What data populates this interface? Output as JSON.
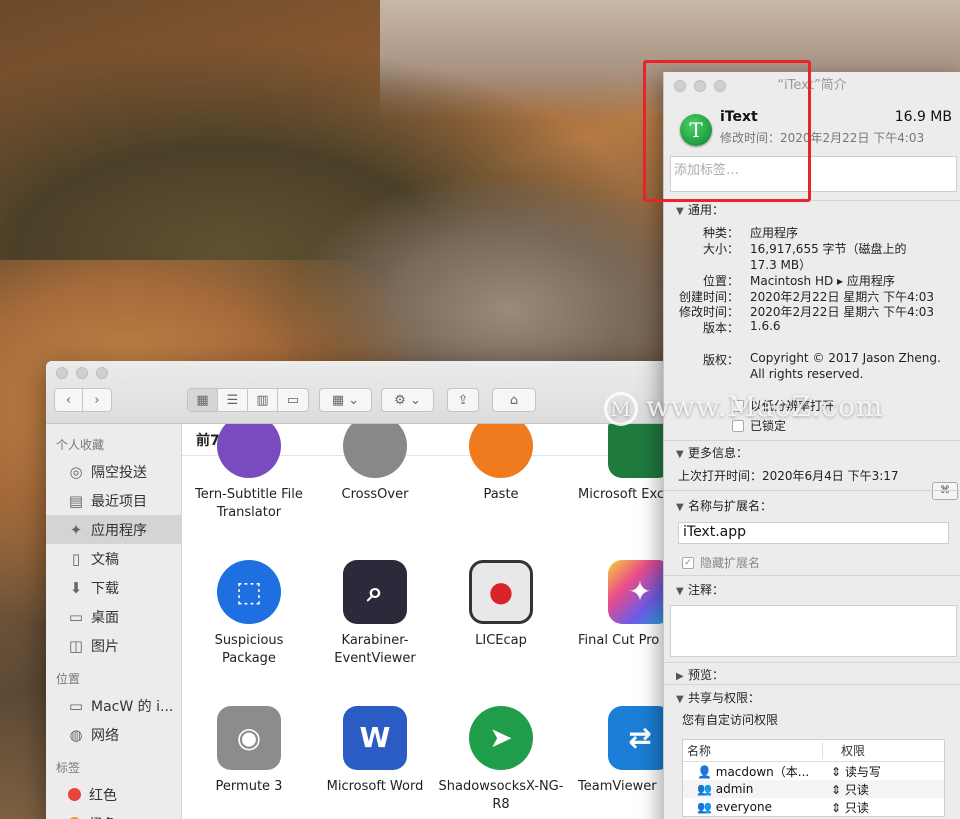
{
  "finder": {
    "section_title": "前7天",
    "sidebar": {
      "favorites_header": "个人收藏",
      "favorites": [
        {
          "label": "隔空投送",
          "icon": "◎"
        },
        {
          "label": "最近项目",
          "icon": "▤"
        },
        {
          "label": "应用程序",
          "icon": "✦"
        },
        {
          "label": "文稿",
          "icon": "▯"
        },
        {
          "label": "下载",
          "icon": "⬇"
        },
        {
          "label": "桌面",
          "icon": "▭"
        },
        {
          "label": "图片",
          "icon": "◫"
        }
      ],
      "locations_header": "位置",
      "locations": [
        {
          "label": "MacW 的 i...",
          "icon": "▭"
        },
        {
          "label": "网络",
          "icon": "◍"
        }
      ],
      "tags_header": "标签",
      "tags": [
        {
          "label": "红色",
          "color": "#e9453b"
        },
        {
          "label": "橙色",
          "color": "#f39a2b"
        }
      ]
    },
    "apps": [
      {
        "label": "Tern-Subtitle File Translator",
        "color": "#7a4bbf",
        "glyph": ""
      },
      {
        "label": "CrossOver",
        "color": "#7a7a7a",
        "glyph": ""
      },
      {
        "label": "Paste",
        "color": "#f07a1e",
        "glyph": ""
      },
      {
        "label": "Microsoft Exc",
        "color": "#1f7a3e",
        "glyph": ""
      },
      {
        "label": "Suspicious Package",
        "color": "#1e6fe0",
        "glyph": "⬚"
      },
      {
        "label": "Karabiner-EventViewer",
        "color": "#2a2a3a",
        "glyph": "⌕"
      },
      {
        "label": "LICEcap",
        "color": "#3c3c3c",
        "glyph": "●"
      },
      {
        "label": "Final Cut Pro",
        "color": "#2b2b2b",
        "glyph": "✦"
      },
      {
        "label": "Permute 3",
        "color": "#8c8c8c",
        "glyph": "◉"
      },
      {
        "label": "Microsoft Word",
        "color": "#2b5cc4",
        "glyph": "W"
      },
      {
        "label": "ShadowsocksX-NG-R8",
        "color": "#1f9d48",
        "glyph": "➤"
      },
      {
        "label": "TeamViewer",
        "color": "#1c7ed6",
        "glyph": "⇄"
      }
    ]
  },
  "info": {
    "title": "“iText”简介",
    "app_icon_letter": "T",
    "name": "iText",
    "size": "16.9 MB",
    "modified_line": "修改时间：2020年2月22日 下午4:03",
    "tag_placeholder": "添加标签…",
    "general_header": "通用：",
    "general": [
      {
        "k": "种类：",
        "v": "应用程序"
      },
      {
        "k": "大小：",
        "v": "16,917,655 字节（磁盘上的"
      },
      {
        "k": "",
        "v": "17.3 MB）"
      },
      {
        "k": "位置：",
        "v": "Macintosh HD ▸ 应用程序"
      },
      {
        "k": "创建时间：",
        "v": "2020年2月22日 星期六 下午4:03"
      },
      {
        "k": "修改时间：",
        "v": "2020年2月22日 星期六 下午4:03"
      },
      {
        "k": "版本：",
        "v": "1.6.6"
      }
    ],
    "copyright_label": "版权：",
    "copyright_line1": "Copyright © 2017 Jason Zheng.",
    "copyright_line2": "All rights reserved.",
    "cb_low_res": "以低分辨率打开",
    "cb_locked": "已锁定",
    "more_header": "更多信息：",
    "last_opened": "上次打开时间：2020年6月4日 下午3:17",
    "name_ext_header": "名称与扩展名：",
    "name_value": "iText.app",
    "hide_ext": "隐藏扩展名",
    "comments_header": "注释：",
    "preview_header": "预览：",
    "sharing_header": "共享与权限：",
    "custom_access": "您有自定访问权限",
    "perm_col_name": "名称",
    "perm_col_priv": "权限",
    "perms": [
      {
        "name": "macdown（本...",
        "priv": "读与写"
      },
      {
        "name": "admin",
        "priv": "只读"
      },
      {
        "name": "everyone",
        "priv": "只读"
      }
    ]
  },
  "watermark": "www.MacZ.com",
  "colors": {
    "highlight": "#e8242a",
    "sidebar_bg": "#ececec"
  }
}
